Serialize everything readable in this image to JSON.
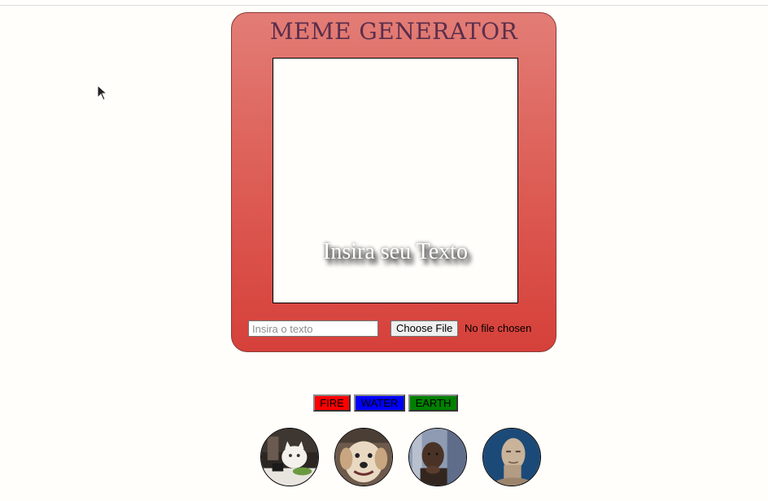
{
  "app": {
    "title": "MEME GENERATOR"
  },
  "canvas": {
    "meme_text": "Insira seu Texto"
  },
  "form": {
    "text_placeholder": "Insira o texto",
    "text_value": "",
    "file_button_label": "Choose File",
    "file_status": "No file chosen"
  },
  "filters": [
    {
      "label": "FIRE",
      "color": "#ff0000"
    },
    {
      "label": "WATER",
      "color": "#0000ff"
    },
    {
      "label": "EARTH",
      "color": "#008000"
    }
  ],
  "presets": [
    {
      "icon": "cat-at-table-meme-thumbnail"
    },
    {
      "icon": "smiling-dog-meme-thumbnail"
    },
    {
      "icon": "thinking-man-meme-thumbnail"
    },
    {
      "icon": "meme-man-thumbnail"
    }
  ],
  "cursor": {
    "icon": "mouse-pointer-icon"
  }
}
